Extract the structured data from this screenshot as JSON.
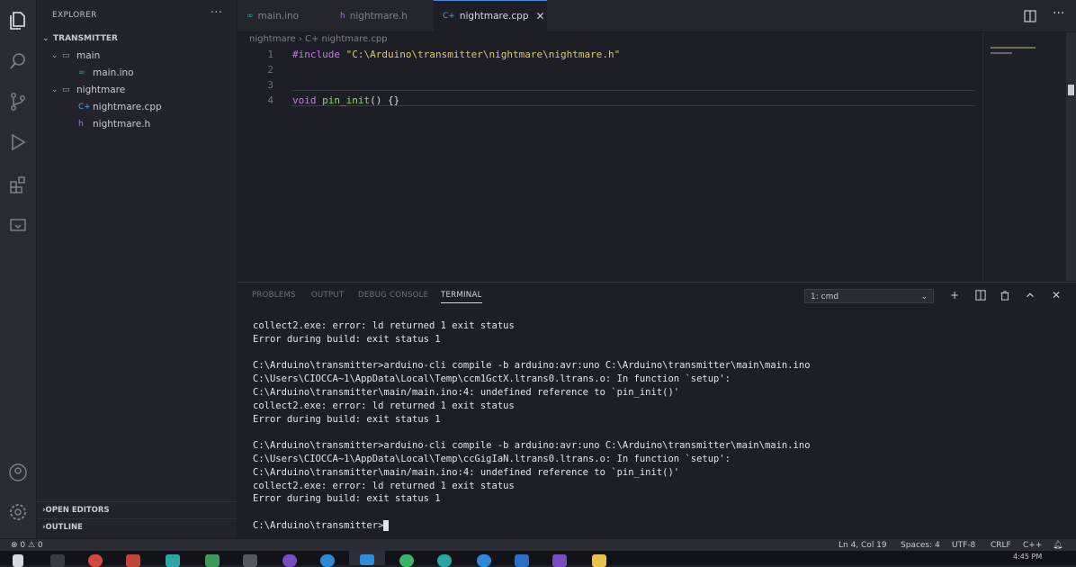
{
  "sidebar": {
    "title": "EXPLORER",
    "more": "···",
    "tree": [
      {
        "label": "TRANSMITTER",
        "chevron": "⌄",
        "icon": ""
      },
      {
        "label": "main",
        "chevron": "⌄",
        "icon": "▭"
      },
      {
        "label": "main.ino",
        "chevron": "",
        "icon": "∞"
      },
      {
        "label": "nightmare",
        "chevron": "⌄",
        "icon": "▭"
      },
      {
        "label": "nightmare.cpp",
        "chevron": "",
        "icon": "C+"
      },
      {
        "label": "nightmare.h",
        "chevron": "",
        "icon": "h"
      }
    ],
    "sections": [
      {
        "label": "OPEN EDITORS",
        "chevron": "›"
      },
      {
        "label": "OUTLINE",
        "chevron": "›"
      }
    ]
  },
  "tabs": [
    {
      "label": "main.ino",
      "icon": "∞",
      "active": false
    },
    {
      "label": "nightmare.h",
      "icon": "h",
      "active": false
    },
    {
      "label": "nightmare.cpp",
      "icon": "C+",
      "active": true,
      "close": "✕"
    }
  ],
  "breadcrumb": "nightmare › C+ nightmare.cpp",
  "editor": {
    "lines": [
      {
        "num": "1",
        "include": "#include",
        "str": "\"C:\\Arduino\\transmitter\\nightmare\\nightmare.h\""
      },
      {
        "num": "2"
      },
      {
        "num": "3"
      },
      {
        "num": "4",
        "kw": "void",
        "fn": "pin_init",
        "rest": "() {}"
      }
    ]
  },
  "panel": {
    "tabs": [
      "PROBLEMS",
      "OUTPUT",
      "DEBUG CONSOLE",
      "TERMINAL"
    ],
    "active_tab": "TERMINAL",
    "terminal_select": "1: cmd",
    "terminal_lines": [
      "collect2.exe: error: ld returned 1 exit status",
      "Error during build: exit status 1",
      "",
      "C:\\Arduino\\transmitter>arduino-cli compile -b arduino:avr:uno C:\\Arduino\\transmitter\\main\\main.ino",
      "C:\\Users\\CIOCCA~1\\AppData\\Local\\Temp\\ccm1GctX.ltrans0.ltrans.o: In function `setup':",
      "C:\\Arduino\\transmitter\\main/main.ino:4: undefined reference to `pin_init()'",
      "collect2.exe: error: ld returned 1 exit status",
      "Error during build: exit status 1",
      "",
      "C:\\Arduino\\transmitter>arduino-cli compile -b arduino:avr:uno C:\\Arduino\\transmitter\\main\\main.ino",
      "C:\\Users\\CIOCCA~1\\AppData\\Local\\Temp\\ccGigIaN.ltrans0.ltrans.o: In function `setup':",
      "C:\\Arduino\\transmitter\\main/main.ino:4: undefined reference to `pin_init()'",
      "collect2.exe: error: ld returned 1 exit status",
      "Error during build: exit status 1",
      ""
    ],
    "prompt": "C:\\Arduino\\transmitter>"
  },
  "statusbar": {
    "problems": "⊗ 0 ⚠ 0",
    "position": "Ln 4, Col 19",
    "spaces": "Spaces: 4",
    "encoding": "UTF-8",
    "eol": "CRLF",
    "language": "C++"
  },
  "taskbar": {
    "time": "4:45 PM"
  },
  "colors": {
    "accent": "#4b8ad6",
    "keyword": "#c678dd",
    "string": "#d8c57a",
    "function": "#8fd46a"
  }
}
